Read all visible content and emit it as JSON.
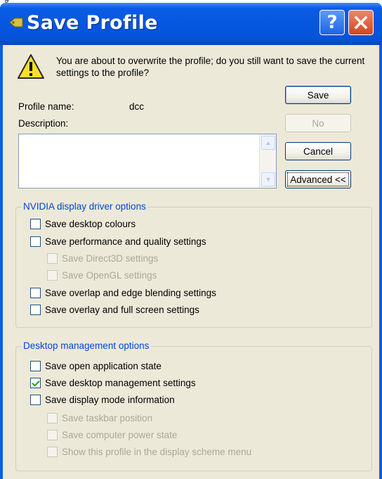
{
  "window": {
    "title": "Save Profile"
  },
  "header_fragment": "g",
  "warning": {
    "text": "You are about to overwrite the profile; do you still want to save the current settings to the profile?"
  },
  "profile": {
    "name_label": "Profile name:",
    "name_value": "dcc",
    "description_label": "Description:",
    "description_value": ""
  },
  "buttons": {
    "save": "Save",
    "no": "No",
    "cancel": "Cancel",
    "advanced": "Advanced <<"
  },
  "nvidia_group": {
    "title": "NVIDIA display driver options",
    "options": [
      {
        "label": "Save desktop colours",
        "checked": false,
        "enabled": true
      },
      {
        "label": "Save performance and quality settings",
        "checked": false,
        "enabled": true
      },
      {
        "label": "Save Direct3D settings",
        "checked": false,
        "enabled": false
      },
      {
        "label": "Save OpenGL settings",
        "checked": false,
        "enabled": false
      },
      {
        "label": "Save overlap and edge blending settings",
        "checked": false,
        "enabled": true
      },
      {
        "label": "Save overlay and full screen settings",
        "checked": false,
        "enabled": true
      }
    ]
  },
  "desktop_group": {
    "title": "Desktop management options",
    "options": [
      {
        "label": "Save open application state",
        "checked": false,
        "enabled": true
      },
      {
        "label": "Save desktop management settings",
        "checked": true,
        "enabled": true
      },
      {
        "label": "Save display mode information",
        "checked": false,
        "enabled": true
      },
      {
        "label": "Save taskbar position",
        "checked": false,
        "enabled": false
      },
      {
        "label": "Save computer power state",
        "checked": false,
        "enabled": false
      },
      {
        "label": "Show this profile in the display scheme menu",
        "checked": false,
        "enabled": false
      }
    ]
  },
  "colors": {
    "titlebar": "#0656e0",
    "dialog_face": "#ece9d8",
    "group_title": "#0046d5",
    "close_button": "#d34521"
  }
}
